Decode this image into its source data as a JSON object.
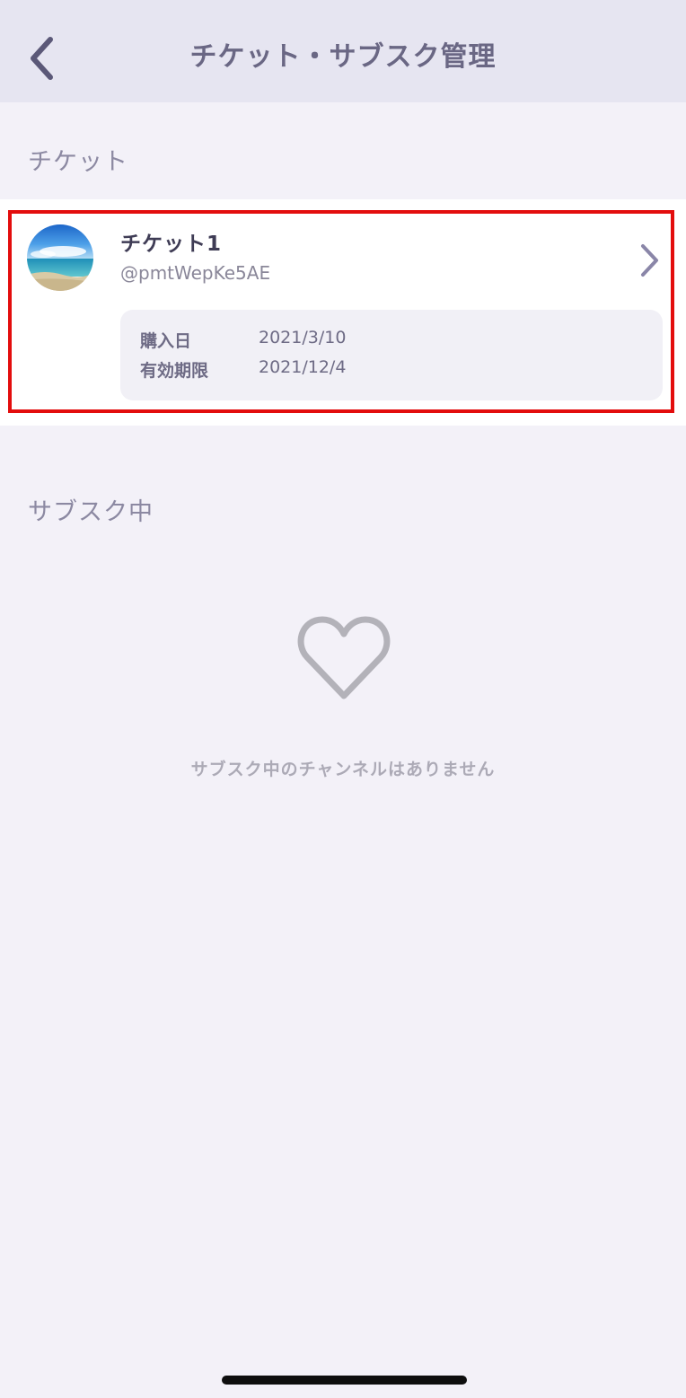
{
  "header": {
    "title": "チケット・サブスク管理",
    "back_icon": "chevron-left-icon"
  },
  "tickets_section": {
    "label": "チケット",
    "items": [
      {
        "name": "チケット1",
        "handle": "@pmtWepKe5AE",
        "avatar": "beach-photo",
        "purchase_label": "購入日",
        "purchase_date": "2021/3/10",
        "expiry_label": "有効期限",
        "expiry_date": "2021/12/4"
      }
    ]
  },
  "subscriptions_section": {
    "label": "サブスク中",
    "empty_icon": "heart-outline-icon",
    "empty_message": "サブスク中のチャンネルはありません"
  },
  "colors": {
    "header_bg": "#e6e5f1",
    "page_bg": "#f3f1f8",
    "accent": "#6a6784",
    "highlight_border": "#e30d0d"
  }
}
